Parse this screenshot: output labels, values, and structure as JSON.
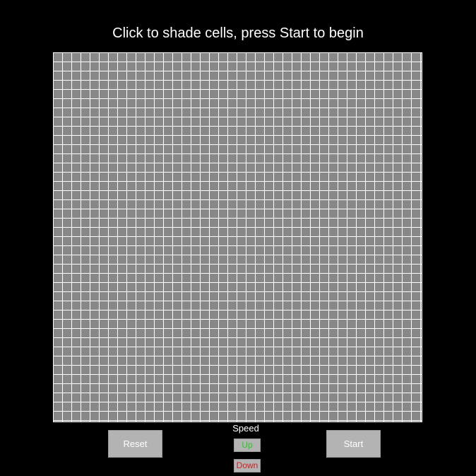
{
  "title": "Click to shade cells, press Start to begin",
  "grid": {
    "rows": 40,
    "cols": 40,
    "cell_color": "#888888",
    "line_color": "#ffffff",
    "shaded_cells": []
  },
  "controls": {
    "reset_label": "Reset",
    "start_label": "Start",
    "speed_label": "Speed",
    "up_label": "Up",
    "down_label": "Down",
    "up_color": "#22cc22",
    "down_color": "#cc2222"
  }
}
